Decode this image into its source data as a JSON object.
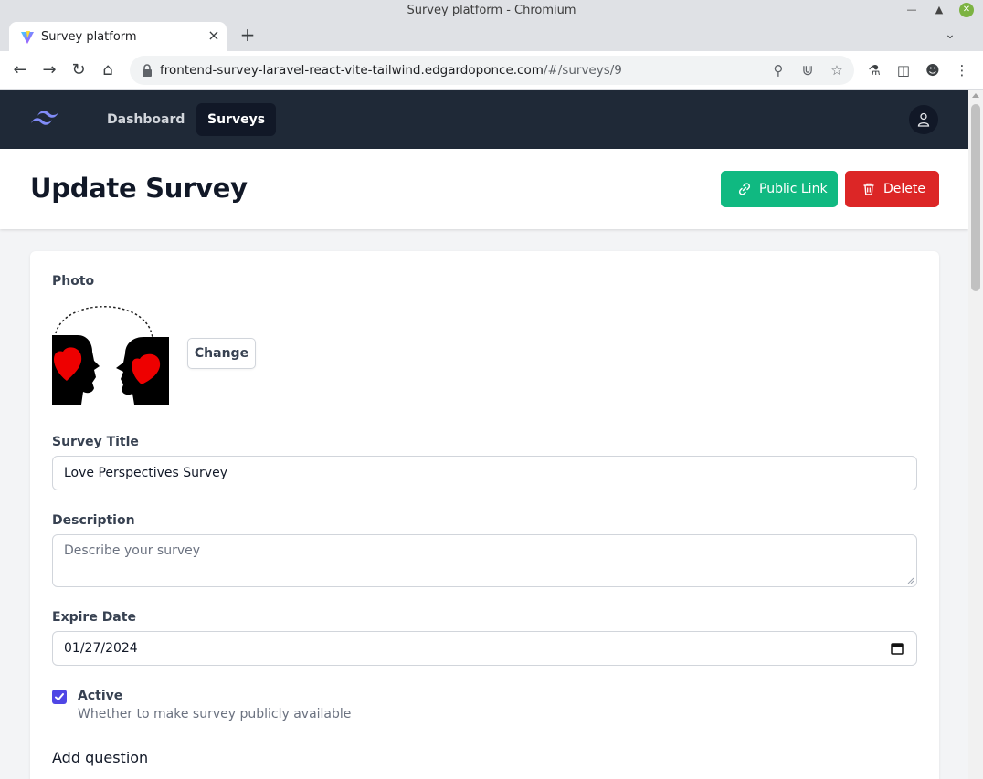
{
  "window": {
    "title": "Survey platform - Chromium"
  },
  "tab": {
    "title": "Survey platform"
  },
  "browser": {
    "url_host": "frontend-survey-laravel-react-vite-tailwind.edgardoponce.com",
    "url_path": "/#/surveys/9"
  },
  "nav": {
    "dashboard": "Dashboard",
    "surveys": "Surveys"
  },
  "header": {
    "title": "Update Survey",
    "public_link": "Public Link",
    "delete": "Delete"
  },
  "form": {
    "photo_label": "Photo",
    "change_label": "Change",
    "title_label": "Survey Title",
    "title_value": "Love Perspectives Survey",
    "description_label": "Description",
    "description_placeholder": "Describe your survey",
    "expire_label": "Expire Date",
    "expire_value": "01/27/2024",
    "active_label": "Active",
    "active_checked": true,
    "active_help": "Whether to make survey publicly available",
    "add_question": "Add question"
  },
  "colors": {
    "nav_bg": "#1f2937",
    "public_link": "#10b981",
    "delete": "#dc2626",
    "checkbox": "#4f46e5"
  }
}
